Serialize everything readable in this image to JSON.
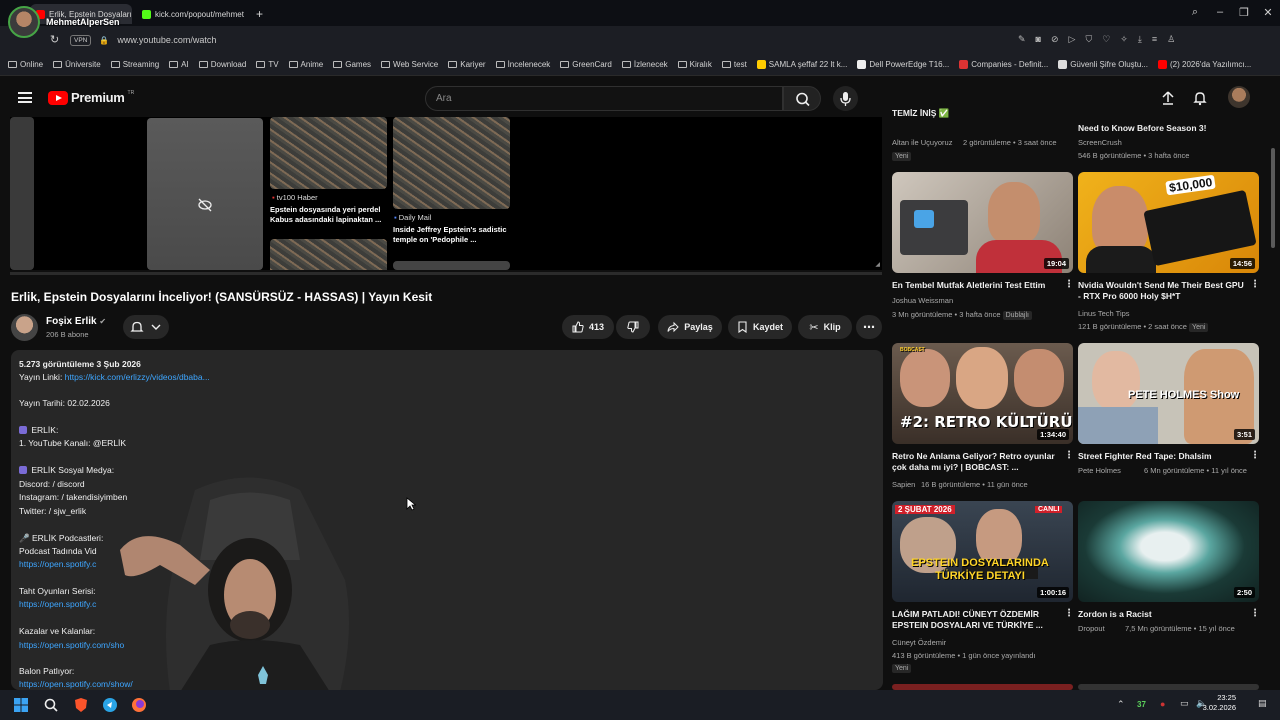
{
  "browser": {
    "tabs": [
      {
        "label": "Erlik, Epstein Dosyalarını İ"
      },
      {
        "label": "kick.com/popout/mehmet"
      }
    ],
    "url": "www.youtube.com/watch",
    "vpn_label": "VPN",
    "bookmarks": [
      "Online",
      "Üniversite",
      "Streaming",
      "AI",
      "Download",
      "TV",
      "Anime",
      "Games",
      "Web Service",
      "Kariyer",
      "İncelenecek",
      "GreenCard",
      "İzlenecek",
      "Kiralık",
      "test",
      "SAMLA şeffaf 22 lt k...",
      "Dell PowerEdge T16...",
      "Companies - Definit...",
      "Güvenli Şifre Oluştu...",
      "(2) 2026'da Yazılımcı..."
    ]
  },
  "overlay": {
    "streamer_name": "MehmetAlperSen"
  },
  "youtube": {
    "logo_text": "Premium",
    "logo_region": "TR",
    "search_placeholder": "Ara",
    "endcards": [
      {
        "source": "tv100 Haber",
        "title": "Epstein dosyasında yeri perdel Kabus adasındaki lapinaktan ..."
      },
      {
        "source": "Daily Mail",
        "title": "Inside Jeffrey Epstein's sadistic temple on 'Pedophile ..."
      }
    ],
    "video_title": "Erlik, Epstein Dosyalarını İnceliyor! (SANSÜRSÜZ - HASSAS) | Yayın Kesit",
    "channel_name": "Foşix Erlik",
    "channel_subs": "206 B abone",
    "likes": "413",
    "share_label": "Paylaş",
    "save_label": "Kaydet",
    "clip_label": "Klip",
    "description": {
      "stats": "5.273 görüntüleme  3 Şub 2026",
      "yayin_link_label": "Yayın Linki: ",
      "yayin_link_url": "https://kick.com/erlizzy/videos/dbaba...",
      "yayin_tarihi": "Yayın Tarihi: 02.02.2026",
      "erlik_header": "ERLİK:",
      "youtube_channel": "1. YouTube Kanalı:  @ERLİK",
      "social_header": "ERLİK Sosyal Medya:",
      "discord": "Discord:  / discord",
      "instagram": "Instagram:  / takendisiyimben",
      "twitter": "Twitter:  / sjw_erlik",
      "podcasts_header": "ERLİK Podcastleri:",
      "podcast_line": "Podcast Tadında Vid",
      "podcast_link": "https://open.spotify.c",
      "taht_header": "Taht Oyunları Serisi:",
      "taht_link": "https://open.spotify.c",
      "kazalar_header": "Kazalar ve Kalanlar:",
      "kazalar_link": "https://open.spotify.com/sho",
      "balon_header": "Balon Patlıyor:",
      "balon_link": "https://open.spotify.com/show/"
    },
    "sidebar": [
      {
        "title": "TEMİZ İNİŞ ✅",
        "channel": "Altan ile Uçuyoruz",
        "meta": "2 görüntüleme • 3 saat önce",
        "badge": "Yeni"
      },
      {
        "title": "Need to Know Before Season 3!",
        "channel": "ScreenCrush",
        "meta": "546 B görüntüleme • 3 hafta önce"
      },
      {
        "title": "En Tembel Mutfak Aletlerini Test Ettim",
        "channel": "Joshua Weissman",
        "meta": "3 Mn görüntüleme • 3 hafta önce",
        "badge": "Dublajlı",
        "duration": "19:04"
      },
      {
        "title": "Nvidia Wouldn't Send Me Their Best GPU - RTX Pro 6000 Holy $H*T",
        "channel": "Linus Tech Tips",
        "meta": "121 B görüntüleme • 2 saat önce",
        "badge": "Yeni",
        "duration": "14:56",
        "thumb_text": "$10,000"
      },
      {
        "title": "Retro Ne Anlama Geliyor? Retro oyunlar çok daha mı iyi? | BOBCAST: ...",
        "channel": "Sapien",
        "meta": "16 B görüntüleme • 11 gün önce",
        "duration": "1:34:40",
        "thumb_text": "#2: RETRO KÜLTÜRÜ",
        "thumb_tag": "BOBCAST"
      },
      {
        "title": "Street Fighter Red Tape: Dhalsim",
        "channel": "Pete Holmes",
        "meta": "6 Mn görüntüleme • 11 yıl önce",
        "duration": "3:51",
        "thumb_text": "PETE HOLMES Show"
      },
      {
        "title": "LAĞIM PATLADI! CÜNEYT ÖZDEMİR EPSTEIN DOSYALARI VE TÜRKİYE ...",
        "channel": "Cüneyt Özdemir",
        "meta": "413 B görüntüleme • 1 gün önce yayınlandı",
        "badge": "Yeni",
        "duration": "1:00:16",
        "thumb_text": "EPSTEIN DOSYALARINDA TÜRKİYE DETAYI",
        "thumb_date": "2 ŞUBAT 2026",
        "thumb_live": "CANLI"
      },
      {
        "title": "Zordon is a Racist",
        "channel": "Dropout",
        "meta": "7,5 Mn görüntüleme • 15 yıl önce",
        "duration": "2:50"
      }
    ]
  },
  "taskbar": {
    "tray_number": "37",
    "time": "23:25",
    "date": "3.02.2026"
  },
  "colors": {
    "youtube_red": "#ff0000",
    "link_blue": "#3ea6ff",
    "page_bg": "#0f0f0f"
  }
}
